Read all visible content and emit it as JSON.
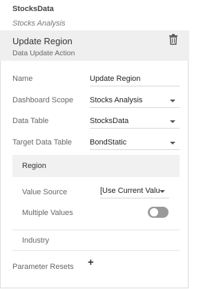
{
  "source": {
    "name": "StocksData",
    "subtitle": "Stocks Analysis"
  },
  "action": {
    "title": "Update Region",
    "type": "Data Update Action",
    "delete_icon": "trash-icon"
  },
  "fields": {
    "name": {
      "label": "Name",
      "value": "Update Region"
    },
    "dashboard_scope": {
      "label": "Dashboard Scope",
      "value": "Stocks Analysis"
    },
    "data_table": {
      "label": "Data Table",
      "value": "StocksData"
    },
    "target_data_table": {
      "label": "Target Data Table",
      "value": "BondStatic"
    }
  },
  "region": {
    "title": "Region",
    "value_source": {
      "label": "Value Source",
      "value": "[Use Current Valu"
    },
    "multiple_values": {
      "label": "Multiple Values",
      "enabled": false
    }
  },
  "industry": {
    "title": "Industry"
  },
  "parameter_resets": {
    "label": "Parameter Resets",
    "add_icon": "plus-icon"
  },
  "colors": {
    "header_bg": "#efefef",
    "toggle_off": "#9a9a9a"
  }
}
